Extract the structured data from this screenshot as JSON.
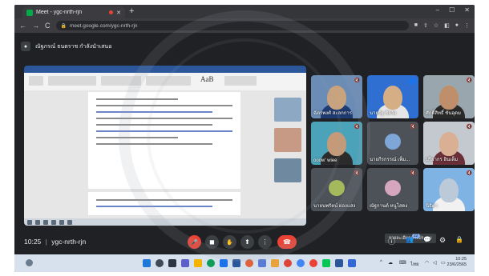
{
  "browser": {
    "tab_title": "Meet - ygc-nrth-rjn",
    "url": "meet.google.com/ygc-nrth-rjn",
    "new_tab_label": "+",
    "tab_close": "✕",
    "win_min": "–",
    "win_max": "☐",
    "win_close": "✕"
  },
  "presenting": {
    "text": "ณัฐภรณ์ ธนตราช กำลังนำเสนอ"
  },
  "presentation": {
    "ribbon_style_text": "AaB"
  },
  "participants": [
    {
      "name": "ฉัตรพงศ์ สะลกการ",
      "skin": "#c9a27e",
      "bg": "#6a8cb5",
      "shirt": "#1f3b73",
      "speaking": false
    },
    {
      "name": "นายรัฐ ชัยวัง",
      "skin": "#d6ae86",
      "bg": "#2e6fd1",
      "shirt": "#e6e6e6",
      "speaking": true
    },
    {
      "name": "ศักดิ์สิทธิ์ ขันอุดม",
      "skin": "#bf8f6b",
      "bg": "#9aa6ad",
      "shirt": "#2a2a2a",
      "speaking": false
    },
    {
      "name": "ooow' wiee",
      "skin": "#c49a78",
      "bg": "#4aa3b8",
      "shirt": "#2b2b2b",
      "speaking": false
    },
    {
      "name": "นายกีรกรรณ์ เพ็ม...",
      "avatar": true,
      "bg": "#4c5258",
      "avatar_color": "#7ea6d6",
      "speaking": false
    },
    {
      "name": "ปริยากร อินเต็ม",
      "skin": "#d9b094",
      "bg": "#c4c9cf",
      "shirt": "#6b2f38",
      "speaking": false
    },
    {
      "name": "นายนพรัตน์ ผ่องแสง",
      "avatar": true,
      "bg": "#4c5258",
      "avatar_color": "#a3b95c",
      "speaking": false
    },
    {
      "name": "ณัฐกานต์ หนูโสดง",
      "avatar": true,
      "bg": "#4c5258",
      "avatar_color": "#d5a6bd",
      "speaking": false
    },
    {
      "name": "นิธิตา",
      "skin": "#bcc9d8",
      "bg": "#7fb3e3",
      "shirt": "#f1f1f1",
      "speaking": false
    }
  ],
  "tooltip": "รายละเอียดการประชุม",
  "controls": {
    "time": "10:25",
    "separator": "|",
    "meeting_code": "ygc-nrth-rjn",
    "mic_icon": "🎤",
    "cam_icon": "◼",
    "hand_icon": "✋",
    "present_icon": "⬆",
    "more_icon": "⋮",
    "end_icon": "☎",
    "info_icon": "ⓘ",
    "people_icon": "👥",
    "people_count": "22",
    "chat_icon": "💬",
    "activities_icon": "⚙",
    "lock_icon": "🔒"
  },
  "taskbar": {
    "tray_lang": "ไทย",
    "time": "10:25",
    "date": "23/6/2565"
  },
  "colors": {
    "meet_bg": "#202124",
    "end_call": "#ea4335",
    "accent": "#1a73e8"
  }
}
